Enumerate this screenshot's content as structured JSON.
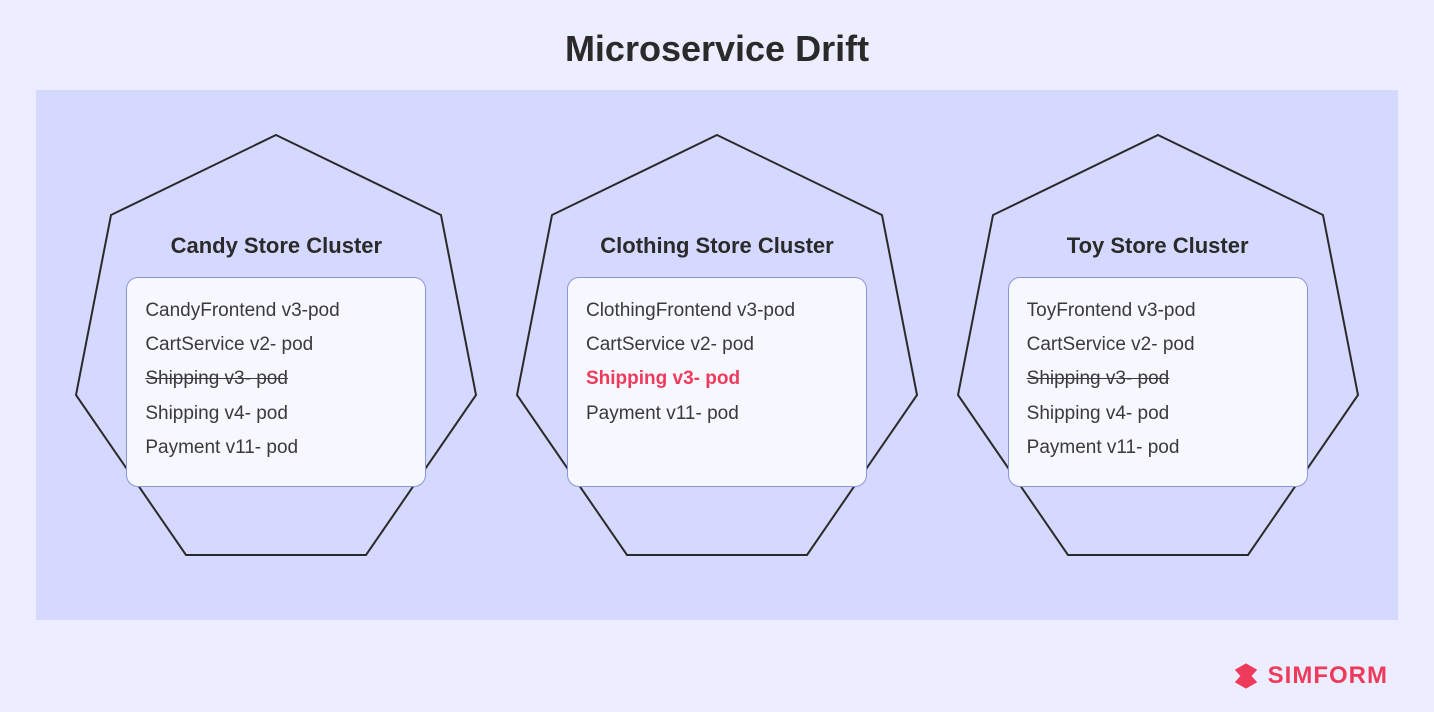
{
  "title": "Microservice Drift",
  "brand": "SIMFORM",
  "colors": {
    "page_bg": "#eceeff",
    "panel_bg": "#d6d9ff",
    "box_bg": "#f6f7ff",
    "box_border": "#8b96d9",
    "text": "#2a2a2a",
    "drift": "#ef3b5b"
  },
  "clusters": [
    {
      "name": "Candy Store Cluster",
      "pods": [
        {
          "label": "CandyFrontend v3-pod",
          "style": "normal"
        },
        {
          "label": "CartService v2- pod",
          "style": "normal"
        },
        {
          "label": "Shipping v3- pod",
          "style": "strike"
        },
        {
          "label": "Shipping v4- pod",
          "style": "normal"
        },
        {
          "label": "Payment v11- pod",
          "style": "normal"
        }
      ]
    },
    {
      "name": "Clothing Store Cluster",
      "pods": [
        {
          "label": "ClothingFrontend v3-pod",
          "style": "normal"
        },
        {
          "label": "CartService v2- pod",
          "style": "normal"
        },
        {
          "label": "Shipping v3- pod",
          "style": "drift"
        },
        {
          "label": "Payment v11- pod",
          "style": "normal"
        }
      ]
    },
    {
      "name": "Toy Store Cluster",
      "pods": [
        {
          "label": "ToyFrontend v3-pod",
          "style": "normal"
        },
        {
          "label": "CartService v2- pod",
          "style": "normal"
        },
        {
          "label": "Shipping v3- pod",
          "style": "strike"
        },
        {
          "label": "Shipping v4- pod",
          "style": "normal"
        },
        {
          "label": "Payment v11- pod",
          "style": "normal"
        }
      ]
    }
  ]
}
